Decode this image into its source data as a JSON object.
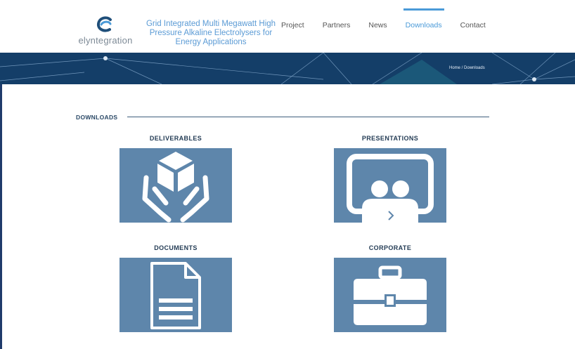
{
  "brand": {
    "name": "elyntegration"
  },
  "tagline": "Grid Integrated Multi Megawatt High Pressure Alkaline Electrolysers for Energy Applications",
  "nav": [
    {
      "label": "Project",
      "active": false
    },
    {
      "label": "Partners",
      "active": false
    },
    {
      "label": "News",
      "active": false
    },
    {
      "label": "Downloads",
      "active": true
    },
    {
      "label": "Contact",
      "active": false
    }
  ],
  "breadcrumb": {
    "home": "Home",
    "separator": " / ",
    "current": "Downloads"
  },
  "section": {
    "title": "DOWNLOADS"
  },
  "categories": [
    {
      "label": "DELIVERABLES",
      "icon": "hands-cube-icon"
    },
    {
      "label": "PRESENTATIONS",
      "icon": "presenter-icon"
    },
    {
      "label": "DOCUMENTS",
      "icon": "document-icon"
    },
    {
      "label": "CORPORATE",
      "icon": "briefcase-icon"
    }
  ],
  "colors": {
    "accent": "#4a9ad8",
    "banner": "#143e68",
    "tile": "#5e86ab"
  }
}
